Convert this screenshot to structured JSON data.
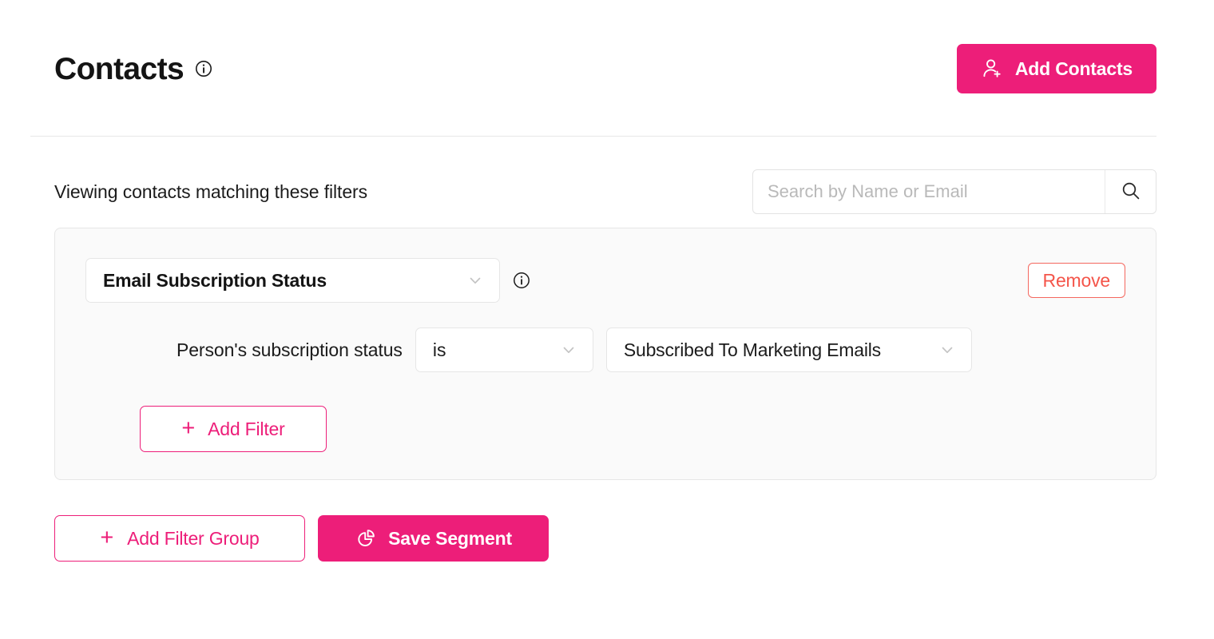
{
  "header": {
    "title": "Contacts",
    "title_info_icon": "info-icon",
    "add_contacts": {
      "label": "Add Contacts",
      "icon": "person-plus-icon",
      "bg_color": "#ED1E79",
      "text_color": "#FFFFFF"
    }
  },
  "filters_bar": {
    "viewing_text": "Viewing contacts matching these filters",
    "search": {
      "placeholder": "Search by Name or Email",
      "value": "",
      "button_icon": "search-icon"
    }
  },
  "filter_card": {
    "attribute_select": {
      "value": "Email Subscription Status",
      "chevron_icon": "chevron-down-icon"
    },
    "attribute_info_icon": "info-icon",
    "remove_button": {
      "label": "Remove",
      "border_color": "#F4685F",
      "text_color": "#F4554A"
    },
    "condition": {
      "label": "Person's subscription status",
      "operator_select": {
        "value": "is",
        "chevron_icon": "chevron-down-icon"
      },
      "value_select": {
        "value": "Subscribed To Marketing Emails",
        "chevron_icon": "chevron-down-icon"
      }
    },
    "add_filter_button": {
      "label": "Add Filter",
      "icon": "plus-icon",
      "accent_color": "#ED1E79"
    },
    "background_color": "#FAFAFA",
    "border_color": "#E6E6E6"
  },
  "bottom_actions": {
    "add_filter_group": {
      "label": "Add Filter Group",
      "icon": "plus-icon",
      "accent_color": "#ED1E79"
    },
    "save_segment": {
      "label": "Save Segment",
      "icon": "pie-chart-icon",
      "bg_color": "#ED1E79",
      "text_color": "#FFFFFF"
    }
  }
}
